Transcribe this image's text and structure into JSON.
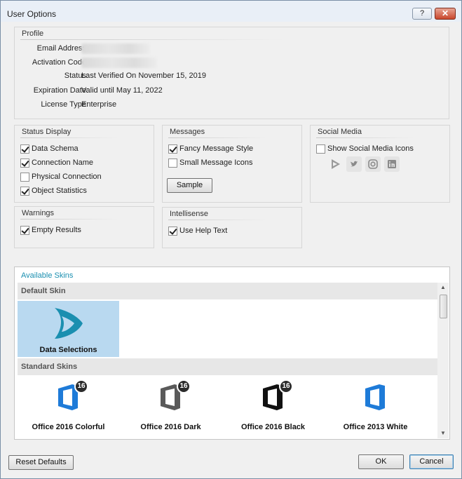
{
  "window": {
    "title": "User Options",
    "help_glyph": "?",
    "close_glyph": "✕"
  },
  "profile": {
    "title": "Profile",
    "email_label": "Email Address:",
    "activation_label": "Activation Code:",
    "status_label": "Status:",
    "status_value": "Last Verified On November 15, 2019",
    "expiration_label": "Expiration Date:",
    "expiration_value": "Valid until May 11, 2022",
    "license_label": "License Type:",
    "license_value": "Enterprise"
  },
  "status_display": {
    "title": "Status Display",
    "items": [
      {
        "label": "Data Schema",
        "checked": true
      },
      {
        "label": "Connection Name",
        "checked": true
      },
      {
        "label": "Physical Connection",
        "checked": false
      },
      {
        "label": "Object Statistics",
        "checked": true
      }
    ]
  },
  "messages": {
    "title": "Messages",
    "items": [
      {
        "label": "Fancy Message Style",
        "checked": true
      },
      {
        "label": "Small Message Icons",
        "checked": false
      }
    ],
    "sample_label": "Sample"
  },
  "social_media": {
    "title": "Social Media",
    "show_label": "Show Social Media Icons",
    "show_checked": false,
    "icons": [
      "data-selections-icon",
      "twitter-icon",
      "instagram-icon",
      "linkedin-icon"
    ]
  },
  "warnings": {
    "title": "Warnings",
    "items": [
      {
        "label": "Empty Results",
        "checked": true
      }
    ]
  },
  "intellisense": {
    "title": "Intellisense",
    "items": [
      {
        "label": "Use Help Text",
        "checked": true
      }
    ]
  },
  "skins": {
    "title": "Available Skins",
    "default_header": "Default Skin",
    "default_skin": "Data Selections",
    "standard_header": "Standard Skins",
    "standard": [
      {
        "name": "Office 2016 Colorful",
        "color": "#1e7bd8",
        "badge": "16"
      },
      {
        "name": "Office 2016 Dark",
        "color": "#5a5a5a",
        "badge": "16"
      },
      {
        "name": "Office 2016 Black",
        "color": "#111111",
        "badge": "16"
      },
      {
        "name": "Office 2013 White",
        "color": "#1e7bd8",
        "badge": ""
      }
    ]
  },
  "buttons": {
    "reset": "Reset Defaults",
    "ok": "OK",
    "cancel": "Cancel"
  },
  "colors": {
    "accent": "#1a8fb0",
    "selected_tile": "#b9d9f0"
  }
}
